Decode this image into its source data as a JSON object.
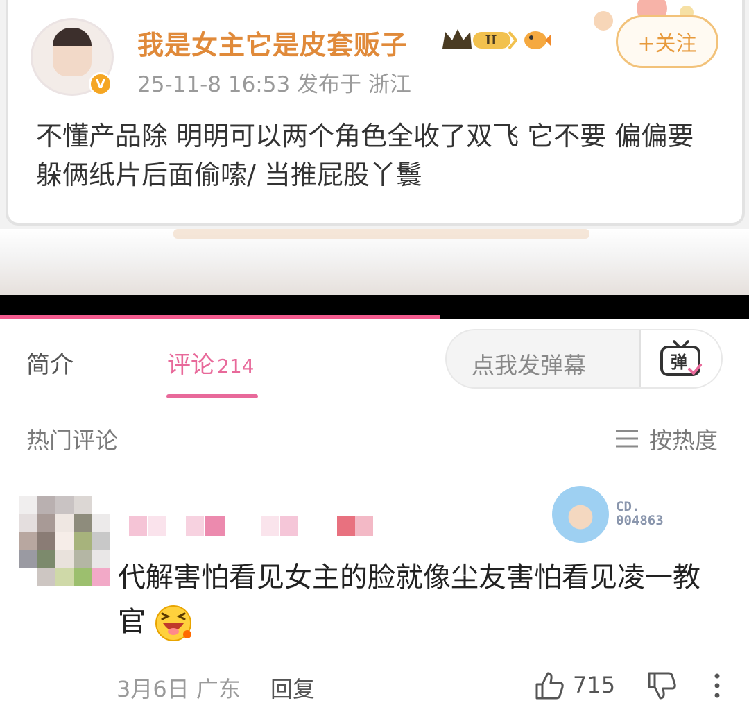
{
  "post": {
    "author": "我是女主它是皮套贩子",
    "level_badge": "II",
    "meta": "25-11-8 16:53  发布于 浙江",
    "follow_label": "+关注",
    "verified_mark": "V",
    "body": "不懂产品除 明明可以两个角色全收了双飞 它不要 偏偏要躲俩纸片后面偷嗦/ 当推屁股丫鬟"
  },
  "player": {
    "progress_fraction": 0.587
  },
  "tabs": {
    "intro": "简介",
    "comments": "评论",
    "comments_count": "214"
  },
  "danmaku": {
    "placeholder": "点我发弹幕",
    "icon_label": "弹"
  },
  "comments_header": {
    "title": "热门评论",
    "sort_label": "按热度"
  },
  "comment": {
    "badge_code_line1": "CD.",
    "badge_code_line2": "004863",
    "text": "代解害怕看见女主的脸就像尘友害怕看见凌一教官",
    "date_location": "3月6日 广东",
    "reply_label": "回复",
    "likes": "715"
  },
  "colors": {
    "accent": "#e8699a",
    "progress": "#f45b8f",
    "follow": "#e79a3c",
    "author_name": "#e08a3a"
  },
  "icons": {
    "danmaku": "danmaku-tv-icon",
    "sort": "menu-lines-icon",
    "like": "thumbs-up-icon",
    "dislike": "thumbs-down-icon",
    "more": "more-vertical-icon"
  }
}
